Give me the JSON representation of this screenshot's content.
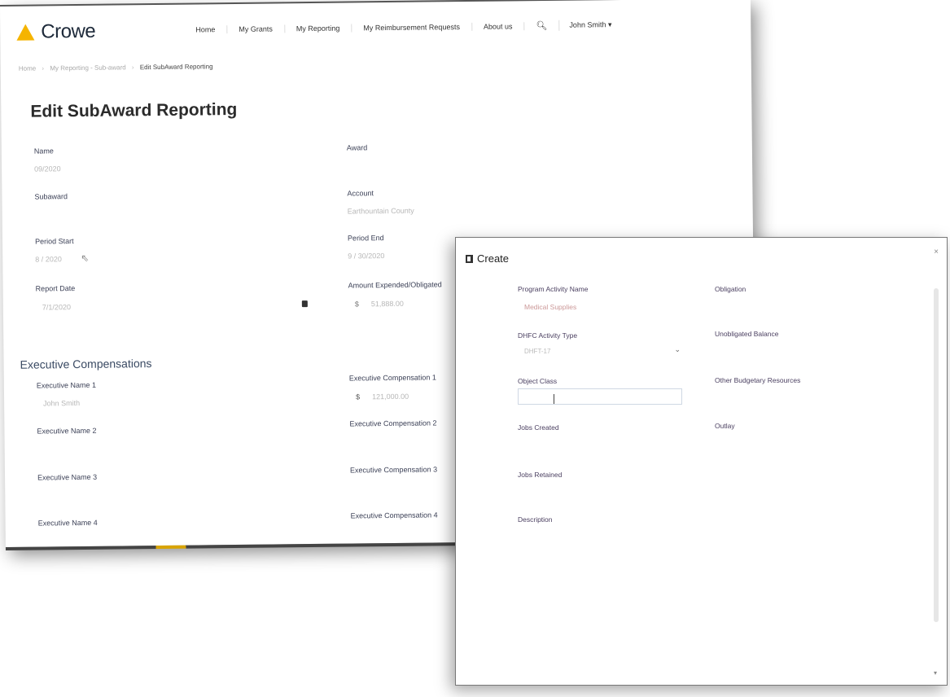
{
  "app": {
    "logo_text": "Crowe",
    "brand_color": "#f5b400"
  },
  "nav": {
    "items": [
      "Home",
      "My Grants",
      "My Reporting",
      "My Reimbursement Requests",
      "About us"
    ],
    "user": "John Smith ▾"
  },
  "breadcrumb": {
    "items": [
      "Home",
      "My Reporting - Sub-award"
    ],
    "current": "Edit SubAward Reporting"
  },
  "page": {
    "title": "Edit SubAward Reporting"
  },
  "form": {
    "name_label": "Name",
    "name_value": "09/2020",
    "award_label": "Award",
    "subaward_label": "Subaward",
    "account_label": "Account",
    "account_value": "Earthountain County",
    "period_start_label": "Period Start",
    "period_start_value": "8 / 2020",
    "period_end_label": "Period End",
    "period_end_value": "9 / 30/2020",
    "report_date_label": "Report Date",
    "report_date_value": "7/1/2020",
    "amount_label": "Amount Expended/Obligated",
    "amount_prefix": "$",
    "amount_value": "51,888.00"
  },
  "exec": {
    "section_title": "Executive Compensations",
    "name1_label": "Executive Name 1",
    "name1_value": "John Smith",
    "comp1_label": "Executive Compensation 1",
    "comp1_prefix": "$",
    "comp1_value": "121,000.00",
    "name2_label": "Executive Name 2",
    "comp2_label": "Executive Compensation 2",
    "name3_label": "Executive Name 3",
    "comp3_label": "Executive Compensation 3",
    "name4_label": "Executive Name 4",
    "comp4_label": "Executive Compensation 4"
  },
  "dialog": {
    "title": "Create",
    "close": "×",
    "program_activity_label": "Program Activity Name",
    "program_activity_value": "Medical Supplies",
    "obligation_label": "Obligation",
    "dhfc_label": "DHFC Activity Type",
    "dhfc_value": "DHFT-17",
    "unobligated_label": "Unobligated Balance",
    "object_class_label": "Object Class",
    "other_budgetary_label": "Other Budgetary Resources",
    "jobs_created_label": "Jobs Created",
    "outlay_label": "Outlay",
    "jobs_retained_label": "Jobs Retained",
    "description_label": "Description"
  }
}
